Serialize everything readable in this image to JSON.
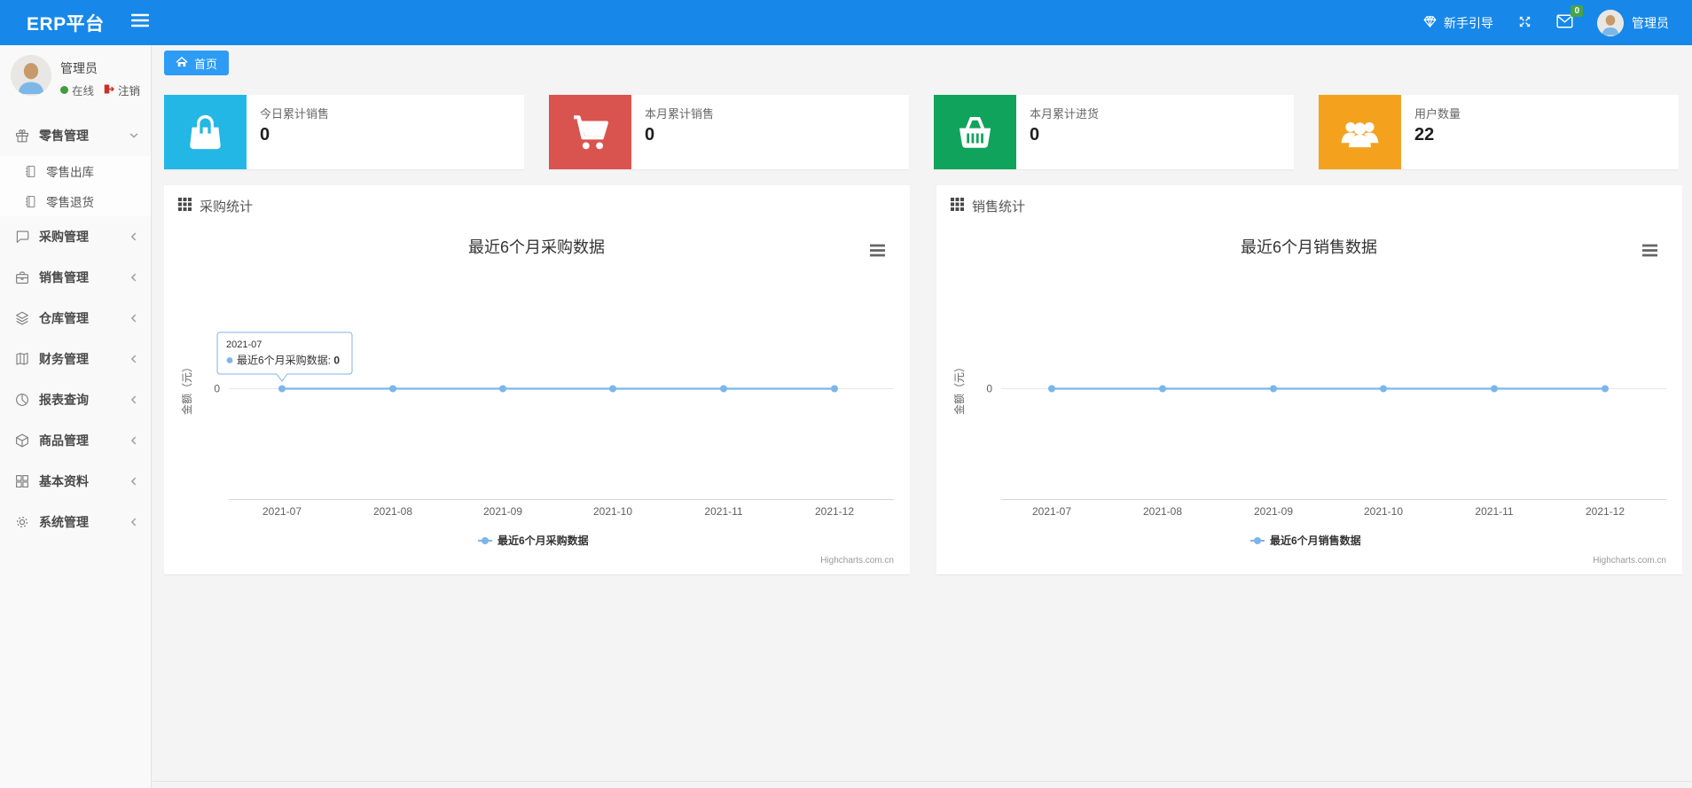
{
  "colors": {
    "navbar_blue": "#1788e9",
    "tab_blue": "#2e9cf4",
    "chart_line_blue": "#7cb5ec",
    "badge_green": "#47a447",
    "online_green": "#3f9c3f",
    "logout_red": "#c9302c"
  },
  "navbar": {
    "brand": "ERP平台",
    "guide_label": "新手引导",
    "message_badge": "0",
    "username": "管理员"
  },
  "sidebar": {
    "user": {
      "name": "管理员",
      "status": "在线",
      "logout_label": "注销"
    },
    "menu": [
      {
        "label": "零售管理",
        "icon": "gift-icon",
        "state": "expanded",
        "children": [
          {
            "label": "零售出库",
            "icon": "journal-icon"
          },
          {
            "label": "零售退货",
            "icon": "journal-icon"
          }
        ]
      },
      {
        "label": "采购管理",
        "icon": "chat-icon",
        "state": "collapsed"
      },
      {
        "label": "销售管理",
        "icon": "briefcase-icon",
        "state": "collapsed"
      },
      {
        "label": "仓库管理",
        "icon": "layers-icon",
        "state": "collapsed"
      },
      {
        "label": "财务管理",
        "icon": "ledger-icon",
        "state": "collapsed"
      },
      {
        "label": "报表查询",
        "icon": "pie-chart-icon",
        "state": "collapsed"
      },
      {
        "label": "商品管理",
        "icon": "box-icon",
        "state": "collapsed"
      },
      {
        "label": "基本资料",
        "icon": "grid-icon",
        "state": "collapsed"
      },
      {
        "label": "系统管理",
        "icon": "gear-icon",
        "state": "collapsed"
      }
    ]
  },
  "breadcrumb": {
    "home_label": "首页"
  },
  "stats": [
    {
      "label": "今日累计销售",
      "value": "0",
      "icon": "shopping-bag-icon",
      "color": "#23b7e5"
    },
    {
      "label": "本月累计销售",
      "value": "0",
      "icon": "shopping-cart-icon",
      "color": "#d9534f"
    },
    {
      "label": "本月累计进货",
      "value": "0",
      "icon": "shopping-basket-icon",
      "color": "#10a35c"
    },
    {
      "label": "用户数量",
      "value": "22",
      "icon": "users-icon",
      "color": "#f4a21d"
    }
  ],
  "panels": [
    {
      "title": "采购统计"
    },
    {
      "title": "销售统计"
    }
  ],
  "chart_data": [
    {
      "type": "line",
      "title": "最近6个月采购数据",
      "categories": [
        "2021-07",
        "2021-08",
        "2021-09",
        "2021-10",
        "2021-11",
        "2021-12"
      ],
      "series": [
        {
          "name": "最近6个月采购数据",
          "values": [
            0,
            0,
            0,
            0,
            0,
            0
          ]
        }
      ],
      "ylabel": "金额（元）",
      "ytick": "0",
      "ylim": [
        0,
        0
      ],
      "grid": true,
      "legend_position": "bottom",
      "line_color": "#7cb5ec",
      "credits": "Highcharts.com.cn",
      "tooltip": {
        "visible": true,
        "header": "2021-07",
        "series_label": "最近6个月采购数据: ",
        "value": "0"
      }
    },
    {
      "type": "line",
      "title": "最近6个月销售数据",
      "categories": [
        "2021-07",
        "2021-08",
        "2021-09",
        "2021-10",
        "2021-11",
        "2021-12"
      ],
      "series": [
        {
          "name": "最近6个月销售数据",
          "values": [
            0,
            0,
            0,
            0,
            0,
            0
          ]
        }
      ],
      "ylabel": "金额（元）",
      "ytick": "0",
      "ylim": [
        0,
        0
      ],
      "grid": true,
      "legend_position": "bottom",
      "line_color": "#7cb5ec",
      "credits": "Highcharts.com.cn",
      "tooltip": {
        "visible": false
      }
    }
  ]
}
